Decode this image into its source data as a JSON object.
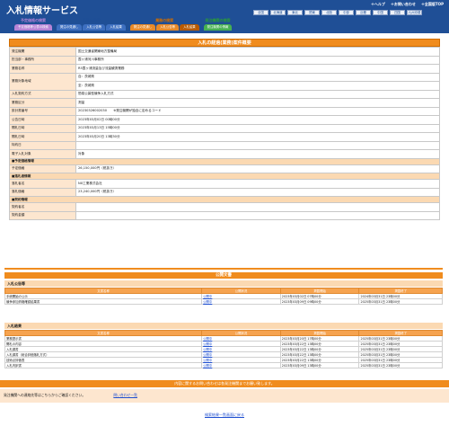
{
  "header": {
    "title": "入札情報サービス",
    "util": [
      "＋ヘルプ",
      "＋お問い合わせ",
      "＋全国版TOP"
    ],
    "regions": [
      "全国",
      "北海道",
      "東北",
      "関東",
      "北陸",
      "中部",
      "近畿",
      "中国",
      "四国",
      "九州沖縄"
    ]
  },
  "categories": [
    {
      "label": "予定価格の検索",
      "tabs": [
        "予定価格等公表の検索"
      ],
      "color": "#9b5fc0",
      "tab_color": "#b784d6"
    },
    {
      "label": "工事の検索",
      "tabs": [
        "発注の見通し",
        "入札公告等",
        "入札結果"
      ],
      "color": "#1f4f96",
      "tab_color": "#3d6fc0"
    },
    {
      "label": "業務の検索",
      "tabs": [
        "発注の見通し",
        "入札公告等",
        "入札結果"
      ],
      "color": "#d06d00",
      "tab_color": "#e88a28"
    },
    {
      "label": "発注機関の検索",
      "tabs": [
        "発注機関の情報"
      ],
      "color": "#2a9a3a",
      "tab_color": "#46b052"
    }
  ],
  "detail": {
    "title": "入札の経過(業務)案件概要",
    "rows": [
      {
        "k": "発注機関",
        "v": "国土交通省関東地方整備局"
      },
      {
        "k": "担当部・事務所",
        "v": "霞ヶ浦河川事務所"
      },
      {
        "k": "業務名称",
        "v": "R5霞ヶ浦流量及び流量観測業務"
      },
      {
        "k": "業務対象地域",
        "v": "自：茨城県",
        "v2": "至：茨城県"
      },
      {
        "k": "入札契約方式",
        "v": "簡易公募型競争入札方式"
      },
      {
        "k": "業務区分",
        "v": "測量"
      },
      {
        "k": "設計書番号",
        "v": "20230326002030　　※発注機関が独自に定めるコード"
      },
      {
        "k": "公告日時",
        "v": "2023年03月02日 00時00分"
      },
      {
        "k": "開札日時",
        "v": "2023年03月13日 15時00分"
      },
      {
        "k": "開札日時",
        "v": "2023年03月20日 13時30分"
      },
      {
        "k": "特約日",
        "v": ""
      },
      {
        "k": "電子入札対象",
        "v": "対象"
      }
    ],
    "group1": "■予定価格情報",
    "price_rows": [
      {
        "k": "予定価格",
        "v": "26,150,000円（税抜き）"
      }
    ],
    "group2": "■落札者情報",
    "winner_rows": [
      {
        "k": "落札者名",
        "v": "NX工業株式会社"
      },
      {
        "k": "落札価格",
        "v": "23,240,000円（税抜き）"
      }
    ],
    "group3": "■契約情報",
    "contract_rows": [
      {
        "k": "契約者名",
        "v": ""
      },
      {
        "k": "契約金額",
        "v": ""
      }
    ]
  },
  "public": {
    "title": "公開文書",
    "notice_title": "入札公告等",
    "headers": [
      "文書名称",
      "公開状況",
      "掲載開始",
      "掲載終了"
    ],
    "notice_rows": [
      {
        "name": "手続開始の公示",
        "status": "公開中",
        "start": "2023年03月02日 07時00分",
        "end": "2024年03月31日 23時00分"
      },
      {
        "name": "競争参加資格確認結果書",
        "status": "公開中",
        "start": "2023年03月09日 09時00分",
        "end": "2025年03月31日 23時00分"
      }
    ],
    "result_title": "入札結果",
    "result_rows": [
      {
        "name": "業務提示書",
        "status": "公開中",
        "start": "2023年03月20日 17時00分",
        "end": "2025年03月31日 23時00分"
      },
      {
        "name": "開札の内容",
        "status": "公開中",
        "start": "2023年03月22日 13時00分",
        "end": "2025年03月31日 23時00分"
      },
      {
        "name": "入札調書",
        "status": "公開中",
        "start": "2023年03月22日 13時00分",
        "end": "2025年03月31日 23時00分"
      },
      {
        "name": "入札調書（総合評価落札方式）",
        "status": "公開中",
        "start": "2023年03月22日 13時00分",
        "end": "2025年03月31日 23時00分"
      },
      {
        "name": "技術点評価表",
        "status": "公開中",
        "start": "2023年03月22日 13時00分",
        "end": "2025年03月31日 23時00分"
      },
      {
        "name": "入札内訳書",
        "status": "公開中",
        "start": "2023年03月09日 13時00分",
        "end": "2025年03月31日 23時00分"
      }
    ]
  },
  "footer": {
    "note": "内容に関するお問い合わせは各発注機関までお願い致します。",
    "contact_text": "発注機関への連絡先等はこちらからご確認ください。",
    "contact_link": "問い合わせ一覧",
    "back_link": "検索結果一覧画面に戻る"
  },
  "colors": {
    "header": "#1f4f96",
    "accent": "#f08c1e",
    "key_bg": "#fde6cf"
  }
}
